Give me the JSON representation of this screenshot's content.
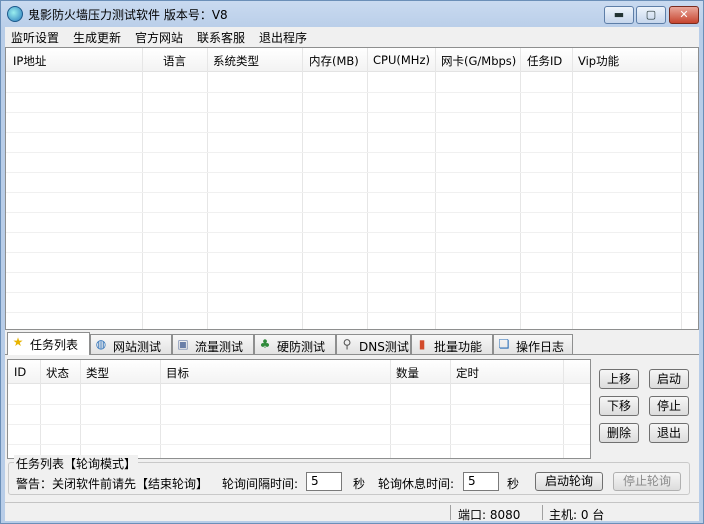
{
  "window": {
    "title": "鬼影防火墙压力测试软件  版本号：V8",
    "minimize": "▬",
    "maximize": "▢",
    "close": "✕"
  },
  "menu": [
    "监听设置",
    "生成更新",
    "官方网站",
    "联系客服",
    "退出程序"
  ],
  "main_table": {
    "columns": [
      "IP地址",
      "语言",
      "系统类型",
      "内存(MB)",
      "CPU(MHz)",
      "网卡(G/Mbps)",
      "任务ID",
      "Vip功能"
    ],
    "rows": []
  },
  "tabs": [
    {
      "label": "任务列表",
      "icon": "star-icon",
      "glyph": "★",
      "color": "#e8b400"
    },
    {
      "label": "网站测试",
      "icon": "globe-icon",
      "glyph": "◍",
      "color": "#2a6fb8"
    },
    {
      "label": "流量测试",
      "icon": "cube-icon",
      "glyph": "▣",
      "color": "#6a7fa8"
    },
    {
      "label": "硬防测试",
      "icon": "network-icon",
      "glyph": "♣",
      "color": "#2f8a3a"
    },
    {
      "label": "DNS测试",
      "icon": "magnifier-icon",
      "glyph": "⚲",
      "color": "#555555"
    },
    {
      "label": "批量功能",
      "icon": "bar-chart-icon",
      "glyph": "▮",
      "color": "#d24a2a"
    },
    {
      "label": "操作日志",
      "icon": "chat-icon",
      "glyph": "❏",
      "color": "#2a6fb8"
    }
  ],
  "task_table": {
    "columns": [
      "ID",
      "状态",
      "类型",
      "目标",
      "数量",
      "定时"
    ],
    "rows": []
  },
  "buttons": {
    "move_up": "上移",
    "start": "启动",
    "move_down": "下移",
    "stop": "停止",
    "delete": "删除",
    "exit": "退出"
  },
  "poll": {
    "group_title": "任务列表【轮询模式】",
    "warning": "警告：关闭软件前请先【结束轮询】",
    "interval_label": "轮询间隔时间:",
    "interval_value": "5",
    "interval_unit": "秒",
    "rest_label": "轮询休息时间:",
    "rest_value": "5",
    "rest_unit": "秒",
    "start_button": "启动轮询",
    "stop_button": "停止轮询"
  },
  "status": {
    "port": "端口: 8080",
    "hosts": "主机: 0 台"
  }
}
